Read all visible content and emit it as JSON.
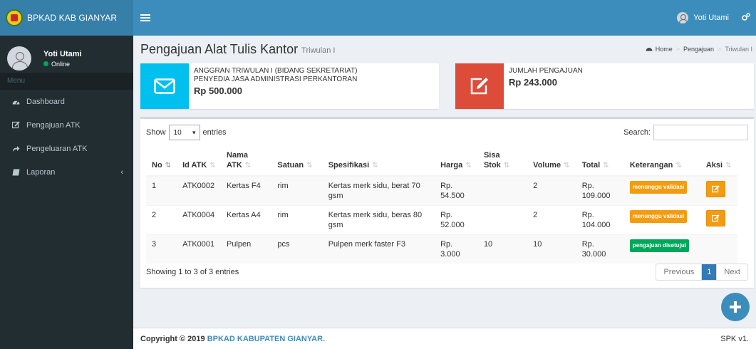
{
  "app": {
    "logo_text": "BPKAD KAB GIANYAR"
  },
  "navbar": {
    "user_name": "Yoti Utami"
  },
  "sidebar": {
    "user_name": "Yoti Utami",
    "status": "Online",
    "menu_header": "Menu",
    "items": [
      {
        "label": "Dashboard",
        "icon": "dashboard-icon"
      },
      {
        "label": "Pengajuan ATK",
        "icon": "edit-icon"
      },
      {
        "label": "Pengeluaran ATK",
        "icon": "share-icon"
      },
      {
        "label": "Laporan",
        "icon": "book-icon"
      }
    ]
  },
  "header": {
    "title": "Pengajuan Alat Tulis Kantor",
    "subtitle": "Triwulan I",
    "breadcrumb": [
      "Home",
      "Pengajuan",
      "Triwulan I"
    ]
  },
  "info_boxes": [
    {
      "label_line1": "ANGGRAN TRIWULAN I (BIDANG SEKRETARIAT)",
      "label_line2": "PENYEDIA JASA ADMINISTRASI PERKANTORAN",
      "value": "Rp 500.000",
      "color": "#00c0ef",
      "icon": "envelope-icon"
    },
    {
      "label_line1": "JUMLAH PENGAJUAN",
      "value": "Rp 243.000",
      "color": "#dd4b39",
      "icon": "edit-icon"
    }
  ],
  "table_controls": {
    "show_label": "Show",
    "length_value": "10",
    "entries_label": "entries",
    "search_label": "Search:",
    "search_value": ""
  },
  "table": {
    "headers": [
      "No",
      "Id ATK",
      "Nama ATK",
      "Satuan",
      "Spesifikasi",
      "Harga",
      "Sisa Stok",
      "Volume",
      "Total",
      "Keterangan",
      "Aksi"
    ],
    "rows": [
      {
        "no": "1",
        "id": "ATK0002",
        "nama": "Kertas F4",
        "satuan": "rim",
        "spesifikasi": "Kertas merk sidu, berat 70 gsm",
        "harga": "Rp. 54.500",
        "sisa": "",
        "volume": "2",
        "total": "Rp. 109.000",
        "keterangan": "menunggu validasi",
        "status": "warning",
        "aksi": true
      },
      {
        "no": "2",
        "id": "ATK0004",
        "nama": "Kertas A4",
        "satuan": "rim",
        "spesifikasi": "Kertas merk sidu, beras 80 gsm",
        "harga": "Rp. 52.000",
        "sisa": "",
        "volume": "2",
        "total": "Rp. 104.000",
        "keterangan": "menunggu validasi",
        "status": "warning",
        "aksi": true
      },
      {
        "no": "3",
        "id": "ATK0001",
        "nama": "Pulpen",
        "satuan": "pcs",
        "spesifikasi": "Pulpen merk faster F3",
        "harga": "Rp. 3.000",
        "sisa": "10",
        "volume": "10",
        "total": "Rp. 30.000",
        "keterangan": "pengajuan disetujui",
        "status": "success",
        "aksi": false
      }
    ]
  },
  "pagination": {
    "info": "Showing 1 to 3 of 3 entries",
    "previous": "Previous",
    "current": "1",
    "next": "Next"
  },
  "footer": {
    "copyright_prefix": "Copyright © 2019",
    "brand": "BPKAD KABUPATEN GIANYAR.",
    "version": "SPK v1."
  }
}
